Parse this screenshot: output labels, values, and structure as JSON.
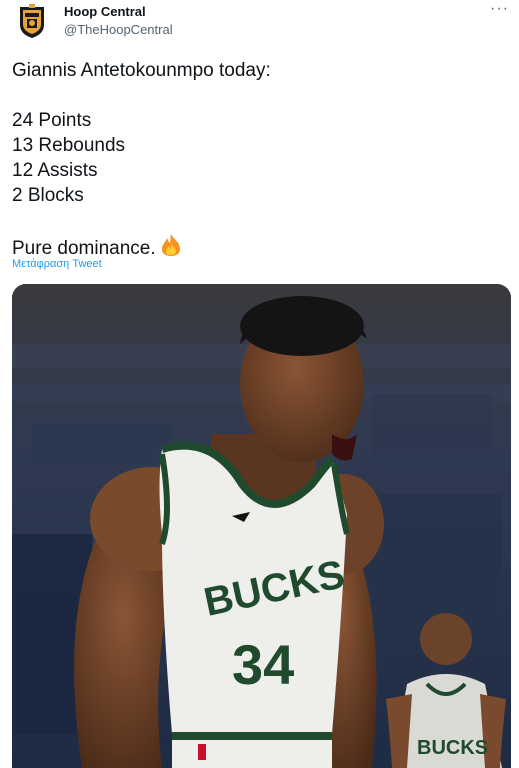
{
  "tweet": {
    "author_name": "Hoop Central",
    "author_handle": "@TheHoopCentral",
    "more_icon": "more-horizontal-icon",
    "lines": [
      "Giannis Antetokounmpo today:",
      "24 Points",
      "13 Rebounds",
      "12 Assists",
      "2 Blocks",
      "Pure dominance."
    ],
    "emoji": "fire-emoji",
    "translate_link": "Μετάφραση Tweet"
  },
  "photo": {
    "jersey_text": "BUCKS",
    "jersey_number": "34",
    "background_jersey_text": "BUCKS"
  },
  "colors": {
    "link": "#1d9bf0",
    "text": "#0f1419",
    "secondary": "#536471",
    "jersey_green": "#1f4a2e",
    "jersey_white": "#eeeeea"
  }
}
